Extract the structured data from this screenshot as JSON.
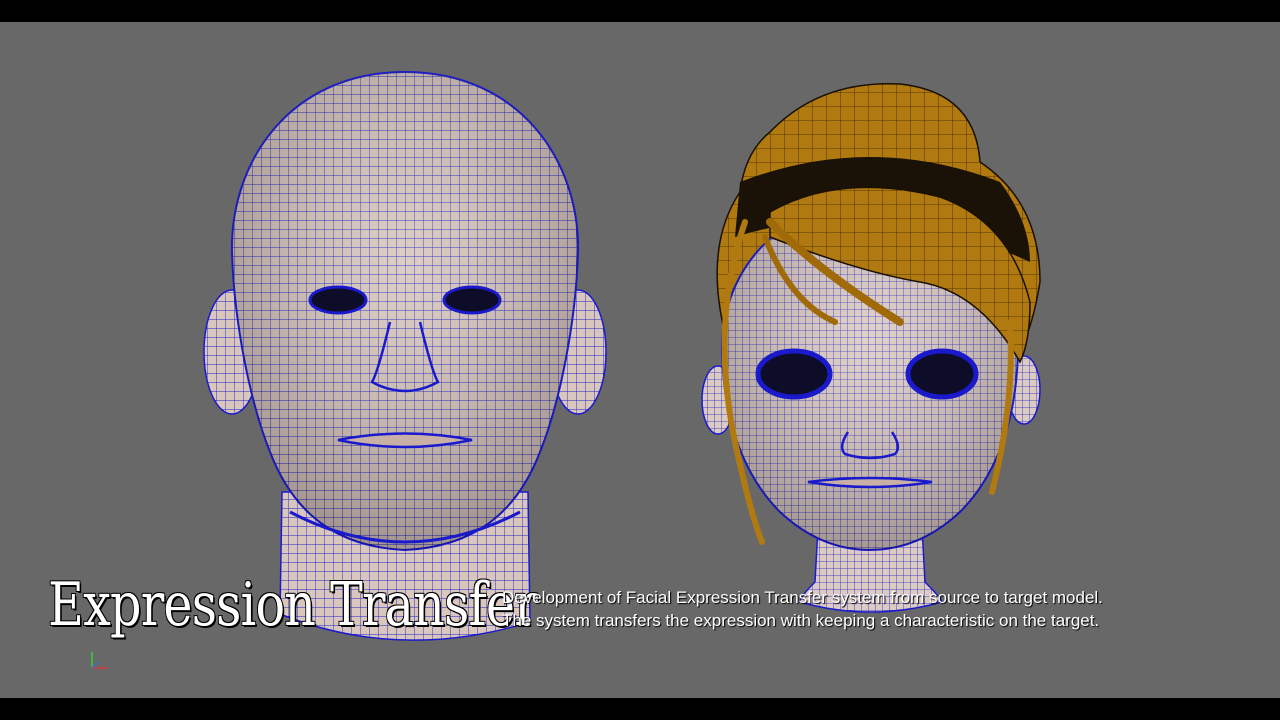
{
  "title": "Expression Transfer",
  "caption": {
    "line1": "Development of Facial Expression Transfer system from source to target model.",
    "line2": "The system transfers the expression with keeping a characteristic on the target."
  },
  "colors": {
    "viewport_bg": "#686868",
    "skin": "#d9c7bd",
    "wireframe": "#1a1acc",
    "hair": "#b07a10",
    "hair_dark": "#2a1a02"
  },
  "icons": {
    "axis": "axis-gizmo-icon"
  }
}
